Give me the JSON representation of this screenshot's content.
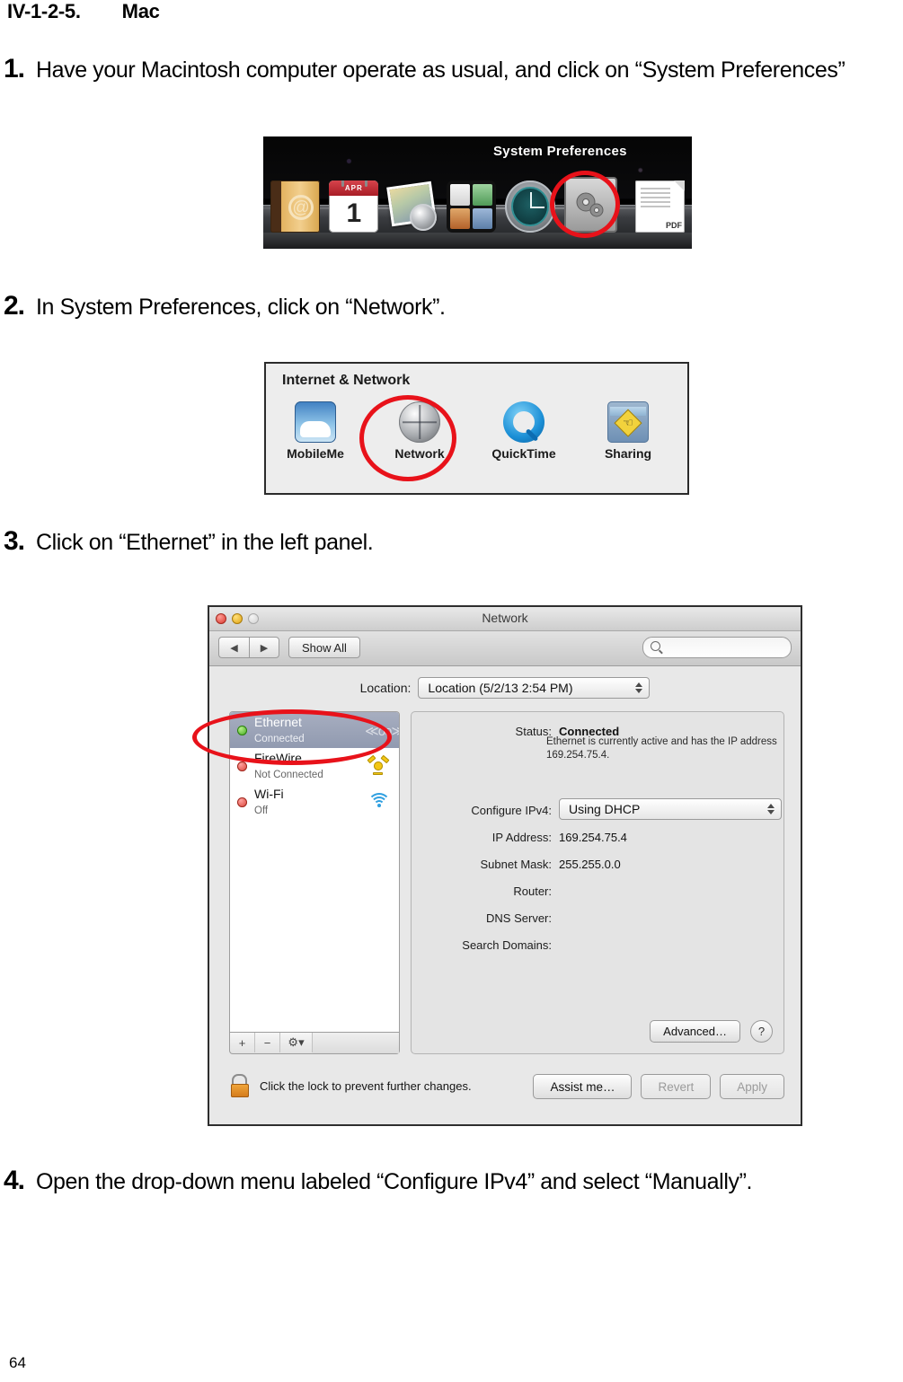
{
  "document": {
    "heading_number": "IV-1-2-5.",
    "heading_title": "Mac",
    "page_number": "64",
    "steps": [
      {
        "num": "1.",
        "text": "Have your Macintosh computer operate as usual, and click on “System Preferences”"
      },
      {
        "num": "2.",
        "text": "In System Preferences, click on “Network”."
      },
      {
        "num": "3.",
        "text": "Click on “Ethernet” in the left panel."
      },
      {
        "num": "4.",
        "text": "Open the drop-down menu labeled “Configure IPv4” and select “Manually”."
      }
    ]
  },
  "figure_dock": {
    "tooltip": "System Preferences",
    "calendar_month": "APR",
    "calendar_day": "1",
    "addressbook_glyph": "@",
    "pdf_label": "PDF",
    "highlight_color": "#e8121a"
  },
  "figure_prefs": {
    "group_title": "Internet & Network",
    "items": [
      {
        "label": "MobileMe",
        "icon": "mobileme-icon"
      },
      {
        "label": "Network",
        "icon": "network-globe-icon"
      },
      {
        "label": "QuickTime",
        "icon": "quicktime-icon"
      },
      {
        "label": "Sharing",
        "icon": "sharing-folder-icon"
      }
    ],
    "highlighted_item": "Network"
  },
  "network_window": {
    "title": "Network",
    "toolbar": {
      "back_glyph": "◀",
      "forward_glyph": "▶",
      "show_all_label": "Show All",
      "search_value": "",
      "search_placeholder": ""
    },
    "location": {
      "label": "Location:",
      "value": "Location (5/2/13 2:54 PM)"
    },
    "interfaces": [
      {
        "name": "Ethernet",
        "status": "Connected",
        "dot": "green",
        "selected": true,
        "icon": "ethernet-icon"
      },
      {
        "name": "FireWire",
        "status": "Not Connected",
        "dot": "red",
        "selected": false,
        "icon": "firewire-icon"
      },
      {
        "name": "Wi-Fi",
        "status": "Off",
        "dot": "red",
        "selected": false,
        "icon": "wifi-icon"
      }
    ],
    "sidebar_buttons": {
      "add": "+",
      "remove": "−",
      "action": "⚙"
    },
    "detail": {
      "status_label": "Status:",
      "status_value": "Connected",
      "status_help": "Ethernet is currently active and has the IP address 169.254.75.4.",
      "configure_label": "Configure IPv4:",
      "configure_value": "Using DHCP",
      "ip_label": "IP Address:",
      "ip_value": "169.254.75.4",
      "mask_label": "Subnet Mask:",
      "mask_value": "255.255.0.0",
      "router_label": "Router:",
      "router_value": "",
      "dns_label": "DNS Server:",
      "dns_value": "",
      "search_label": "Search Domains:",
      "search_value": "",
      "advanced_label": "Advanced…",
      "help_label": "?"
    },
    "footer": {
      "lock_text": "Click the lock to prevent further changes.",
      "assist_label": "Assist me…",
      "revert_label": "Revert",
      "apply_label": "Apply"
    }
  }
}
